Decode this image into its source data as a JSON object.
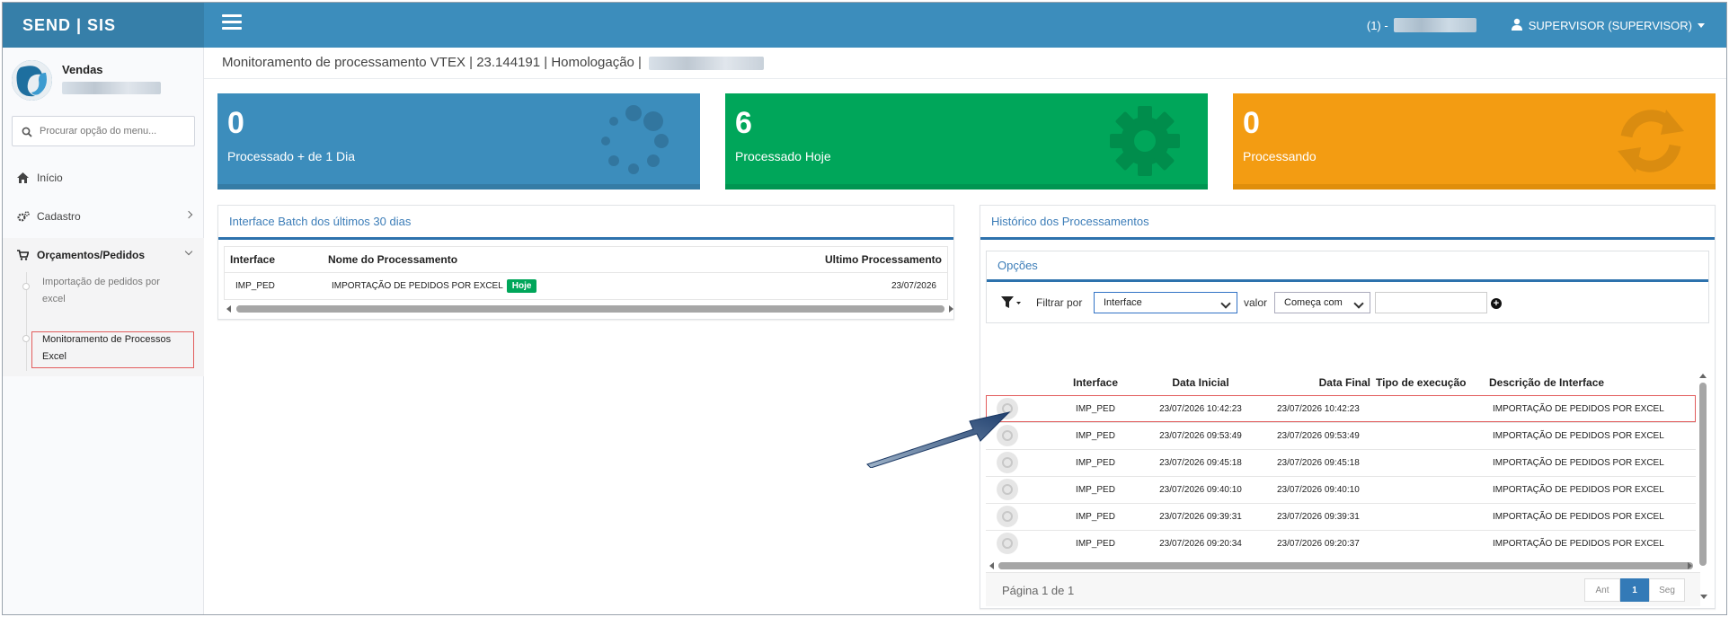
{
  "app": {
    "logo": "SEND | SIS"
  },
  "topbar": {
    "counter": "(1) -",
    "user": "SUPERVISOR (SUPERVISOR)"
  },
  "sidebar": {
    "module": "Vendas",
    "search_placeholder": "Procurar opção do menu...",
    "items": [
      {
        "label": "Início"
      },
      {
        "label": "Cadastro"
      },
      {
        "label": "Orçamentos/Pedidos"
      }
    ],
    "subitems": [
      {
        "line1": "Importação de pedidos por",
        "line2": "excel"
      },
      {
        "line1": "Monitoramento de Processos",
        "line2": "Excel"
      }
    ]
  },
  "page": {
    "title": "Monitoramento de processamento VTEX | 23.144191 | Homologação |"
  },
  "stats": [
    {
      "value": "0",
      "label": "Processado + de 1 Dia",
      "color": "#3c8dbc"
    },
    {
      "value": "6",
      "label": "Processado Hoje",
      "color": "#00a65a"
    },
    {
      "value": "0",
      "label": "Processando",
      "color": "#f39c12"
    }
  ],
  "batch": {
    "title": "Interface Batch dos últimos 30 dias",
    "headers": [
      "Interface",
      "Nome do Processamento",
      "Ultimo Processamento"
    ],
    "rows": [
      {
        "interface": "IMP_PED",
        "name": "IMPORTAÇÃO DE PEDIDOS POR EXCEL",
        "badge": "Hoje",
        "last": "23/07/2026"
      }
    ]
  },
  "history": {
    "title": "Histórico dos Processamentos",
    "options_title": "Opções",
    "filter_label": "Filtrar por",
    "filter_value": "Interface",
    "value_label": "valor",
    "operator_value": "Começa com",
    "headers": [
      "Interface",
      "Data Inicial",
      "Data Final",
      "Tipo de execução",
      "Descrição de Interface"
    ],
    "rows": [
      {
        "interface": "IMP_PED",
        "start": "23/07/2026 10:42:23",
        "end": "23/07/2026 10:42:23",
        "type": "",
        "desc": "IMPORTAÇÃO DE PEDIDOS POR EXCEL"
      },
      {
        "interface": "IMP_PED",
        "start": "23/07/2026 09:53:49",
        "end": "23/07/2026 09:53:49",
        "type": "",
        "desc": "IMPORTAÇÃO DE PEDIDOS POR EXCEL"
      },
      {
        "interface": "IMP_PED",
        "start": "23/07/2026 09:45:18",
        "end": "23/07/2026 09:45:18",
        "type": "",
        "desc": "IMPORTAÇÃO DE PEDIDOS POR EXCEL"
      },
      {
        "interface": "IMP_PED",
        "start": "23/07/2026 09:40:10",
        "end": "23/07/2026 09:40:10",
        "type": "",
        "desc": "IMPORTAÇÃO DE PEDIDOS POR EXCEL"
      },
      {
        "interface": "IMP_PED",
        "start": "23/07/2026 09:39:31",
        "end": "23/07/2026 09:39:31",
        "type": "",
        "desc": "IMPORTAÇÃO DE PEDIDOS POR EXCEL"
      },
      {
        "interface": "IMP_PED",
        "start": "23/07/2026 09:20:34",
        "end": "23/07/2026 09:20:37",
        "type": "",
        "desc": "IMPORTAÇÃO DE PEDIDOS POR EXCEL"
      }
    ],
    "page_info": "Página 1 de 1",
    "prev": "Ant",
    "current_page": "1",
    "next": "Seg"
  }
}
